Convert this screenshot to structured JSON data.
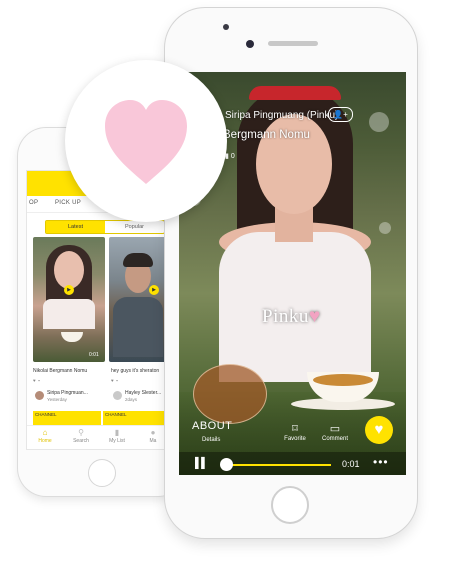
{
  "back_phone": {
    "tabs": [
      "OP",
      "PICK UP",
      ""
    ],
    "segment": {
      "latest": "Latest",
      "popular": "Popular"
    },
    "videos": [
      {
        "caption": "Nikolai Bergmann Nomu",
        "channel": "Siripa Pingmuan...",
        "time": "Yesterday",
        "duration": "0:01"
      },
      {
        "caption": "hey guys it's sheraton",
        "channel": "Hayley Slester...",
        "time": "2days",
        "duration": ""
      }
    ],
    "channel_strips": [
      "CHANNEL",
      "CHANNEL"
    ],
    "nav": [
      {
        "label": "Home",
        "icon": "home-icon"
      },
      {
        "label": "Search",
        "icon": "search-icon"
      },
      {
        "label": "My List",
        "icon": "bookmark-icon"
      },
      {
        "label": "Ma",
        "icon": "user-icon"
      }
    ]
  },
  "front_phone": {
    "title": "Siripa Pingmuang (Pinku)",
    "subtitle": "Bergmann Nomu",
    "count": "0",
    "follow_label": "+",
    "watermark": "Pinku",
    "about": "ABOUT",
    "details": "Details",
    "actions": [
      {
        "label": "Favorite",
        "icon": "bookmark-icon"
      },
      {
        "label": "Comment",
        "icon": "comment-icon"
      }
    ],
    "time": "0:01",
    "more": "•••"
  },
  "colors": {
    "accent": "#ffe200",
    "heart": "#f9c7d9",
    "headband": "#c7262c"
  }
}
